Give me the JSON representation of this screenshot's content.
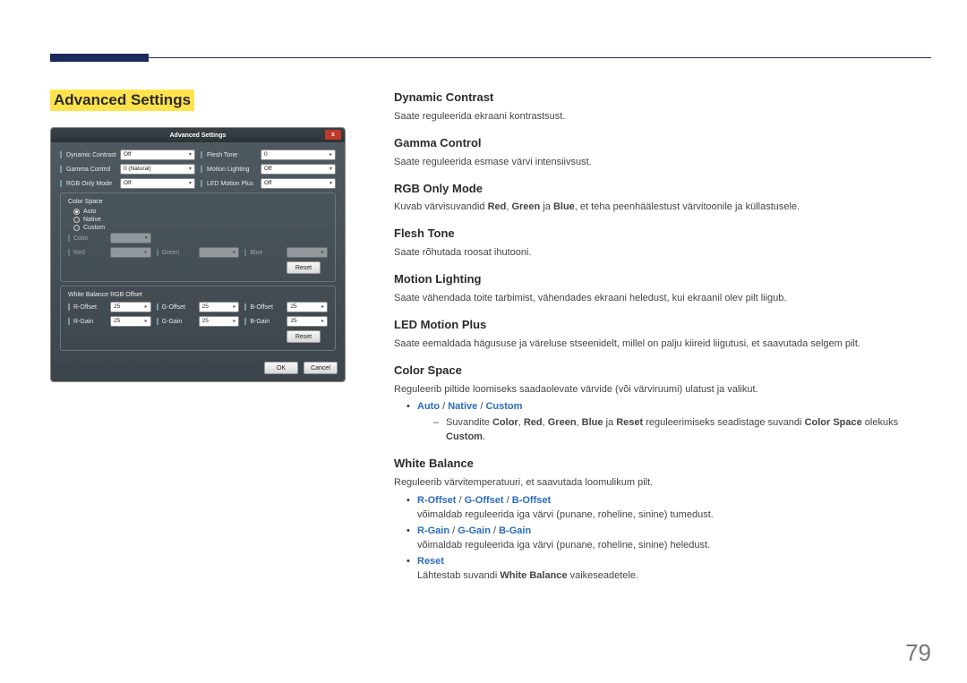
{
  "page_number": "79",
  "section_title": "Advanced Settings",
  "mock": {
    "title": "Advanced Settings",
    "close": "x",
    "rows_top": [
      {
        "l_label": "Dynamic Contrast",
        "l_val": "Off",
        "r_label": "Flesh Tone",
        "r_val": "0"
      },
      {
        "l_label": "Gamma Control",
        "l_val": "0 (Natural)",
        "r_label": "Motion Lighting",
        "r_val": "Off"
      },
      {
        "l_label": "RGB Only Mode",
        "l_val": "Off",
        "r_label": "LED Motion Plus",
        "r_val": "Off"
      }
    ],
    "color_space": {
      "title": "Color Space",
      "opts": [
        "Auto",
        "Native",
        "Custom"
      ],
      "custom_rows": [
        {
          "a": "Color",
          "av": "",
          "b": "",
          "bv": "",
          "c": "",
          "cv": ""
        },
        {
          "a": "Red",
          "av": "",
          "b": "Green",
          "bv": "",
          "c": "Blue",
          "cv": ""
        }
      ],
      "reset": "Reset"
    },
    "wb": {
      "title": "White Balance RGB Offset",
      "rows": [
        {
          "a": "R-Offset",
          "av": "25",
          "b": "G-Offset",
          "bv": "25",
          "c": "B-Offset",
          "cv": "25"
        },
        {
          "a": "R-Gain",
          "av": "25",
          "b": "G-Gain",
          "bv": "25",
          "c": "B-Gain",
          "cv": "25"
        }
      ],
      "reset": "Reset"
    },
    "ok": "OK",
    "cancel": "Cancel"
  },
  "desc": {
    "dynamic_contrast": {
      "h": "Dynamic Contrast",
      "p": "Saate reguleerida ekraani kontrastsust."
    },
    "gamma_control": {
      "h": "Gamma Control",
      "p": "Saate reguleerida esmase värvi intensiivsust."
    },
    "rgb_only": {
      "h": "RGB Only Mode",
      "pre": "Kuvab värvisuvandid ",
      "red": "Red",
      "c1": ", ",
      "green": "Green",
      "c2": " ja ",
      "blue": "Blue",
      "post": ", et teha peenhäälestust värvitoonile ja küllastusele."
    },
    "flesh_tone": {
      "h": "Flesh Tone",
      "p": "Saate rõhutada roosat ihutooni."
    },
    "motion_lighting": {
      "h": "Motion Lighting",
      "p": "Saate vähendada toite tarbimist, vähendades ekraani heledust, kui ekraanil olev pilt liigub."
    },
    "led_motion": {
      "h": "LED Motion Plus",
      "p": "Saate eemaldada hägususe ja väreluse stseenidelt, millel on palju kiireid liigutusi, et saavutada selgem pilt."
    },
    "color_space": {
      "h": "Color Space",
      "p": "Reguleerib piltide loomiseks saadaolevate värvide (või värviruumi) ulatust ja valikut.",
      "opt_auto": "Auto",
      "opt_native": "Native",
      "opt_custom": "Custom",
      "sub_pre": "Suvandite ",
      "sub_color": "Color",
      "sc1": ", ",
      "sub_red": "Red",
      "sc2": ", ",
      "sub_green": "Green",
      "sc3": ", ",
      "sub_blue": "Blue",
      "sc4": " ja ",
      "sub_reset": "Reset",
      "sub_mid": " reguleerimiseks seadistage suvandi ",
      "sub_cs": "Color Space",
      "sub_mid2": " olekuks ",
      "sub_custom": "Custom",
      "sub_end": "."
    },
    "white_balance": {
      "h": "White Balance",
      "p": "Reguleerib värvitemperatuuri, et saavutada loomulikum pilt.",
      "b1_r": "R-Offset",
      "b1_g": "G-Offset",
      "b1_b": "B-Offset",
      "b1_txt": "võimaldab reguleerida iga värvi (punane, roheline, sinine) tumedust.",
      "b2_r": "R-Gain",
      "b2_g": "G-Gain",
      "b2_b": "B-Gain",
      "b2_txt": "võimaldab reguleerida iga värvi (punane, roheline, sinine) heledust.",
      "b3": "Reset",
      "b3_pre": "Lähtestab suvandi ",
      "b3_wb": "White Balance",
      "b3_post": " vaikeseadetele."
    }
  }
}
